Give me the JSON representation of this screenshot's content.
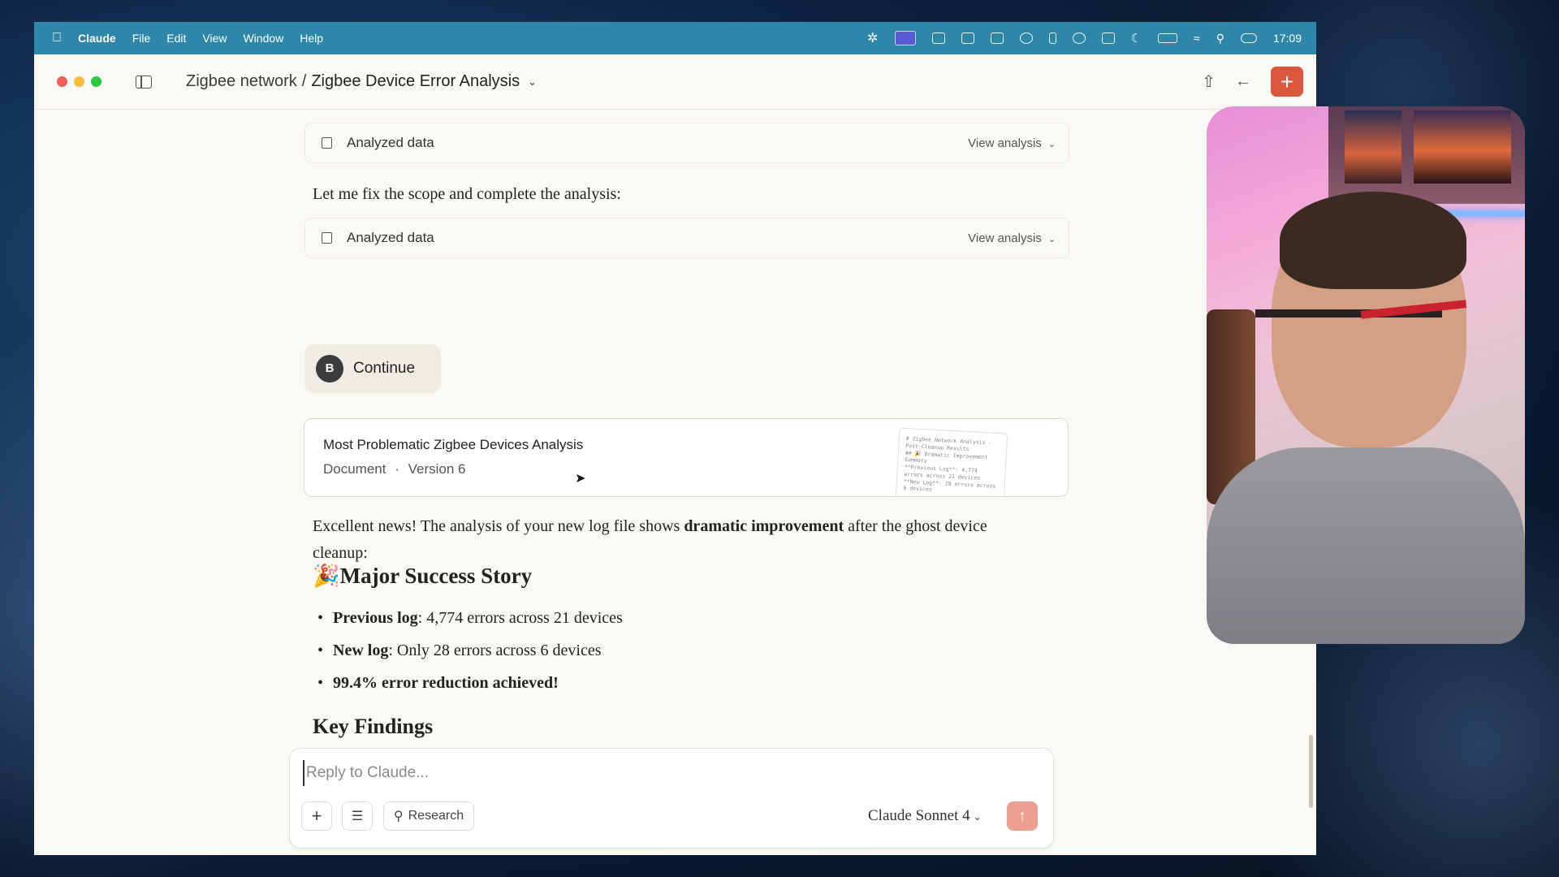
{
  "menubar": {
    "app_name": "Claude",
    "items": [
      "File",
      "Edit",
      "View",
      "Window",
      "Help"
    ],
    "clock": "17:09"
  },
  "titlebar": {
    "project": "Zigbee network",
    "separator": "/",
    "chat_title": "Zigbee Device Error Analysis"
  },
  "tool_cards": [
    {
      "label": "Analyzed data",
      "action": "View analysis"
    },
    {
      "label": "Analyzed data",
      "action": "View analysis"
    }
  ],
  "assistant_text_1": "Let me fix the scope and complete the analysis:",
  "user_message": {
    "avatar_initial": "B",
    "text": "Continue"
  },
  "artifact": {
    "title": "Most Problematic Zigbee Devices Analysis",
    "type": "Document",
    "dot": "·",
    "version": "Version 6",
    "thumbnail_text": "# Zigbee Network Analysis - Post-Cleanup Results\n## 🎉 Dramatic Improvement Summary\n**Previous Log**: 4,774 errors across 21 devices\n**New Log**: 28 errors across 6 devices"
  },
  "response": {
    "intro_before": "Excellent news! The analysis of your new log file shows ",
    "intro_bold": "dramatic improvement",
    "intro_after": " after the ghost device cleanup:",
    "heading_emoji": "🎉",
    "heading": "Major Success Story",
    "bullets": [
      {
        "bold": "Previous log",
        "text": ": 4,774 errors across 21 devices"
      },
      {
        "bold": "New log",
        "text": ": Only 28 errors across 6 devices"
      },
      {
        "bold": "99.4% error reduction achieved!",
        "text": ""
      }
    ],
    "heading_2": "Key Findings"
  },
  "composer": {
    "placeholder": "Reply to Claude...",
    "research_label": "Research",
    "model_name": "Claude",
    "model_version": "Sonnet 4"
  },
  "colors": {
    "menubar": "#2e86a8",
    "accent": "#d9573a",
    "send_disabled": "#eba08f",
    "canvas": "#fbf9f4"
  }
}
